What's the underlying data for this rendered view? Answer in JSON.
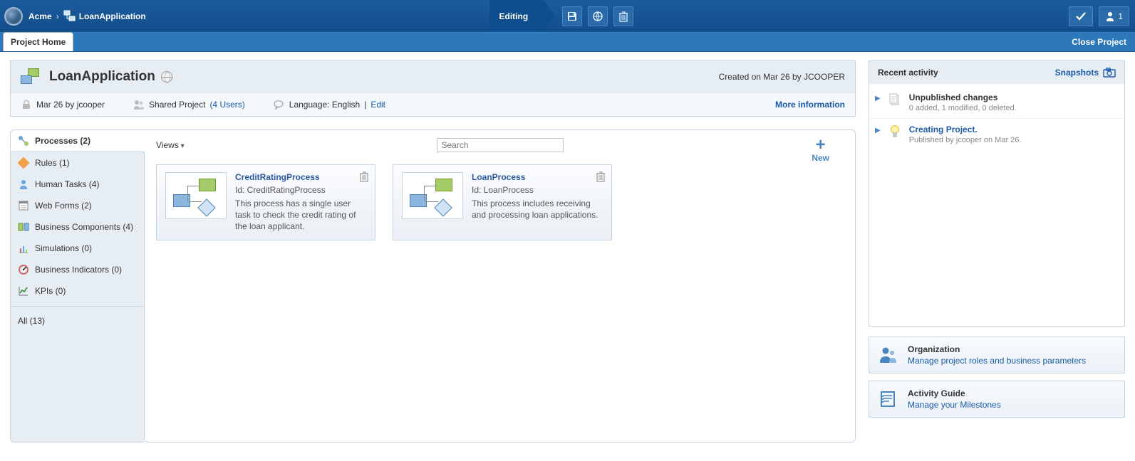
{
  "header": {
    "breadcrumb_root": "Acme",
    "breadcrumb_current": "LoanApplication",
    "mode_label": "Editing",
    "users_online": "1"
  },
  "tabs": {
    "project_home": "Project Home",
    "close_project": "Close Project"
  },
  "project": {
    "title": "LoanApplication",
    "created_text": "Created on Mar 26 by JCOOPER",
    "lock_text": "Mar 26 by jcooper",
    "shared_label": "Shared Project",
    "shared_count": "(4 Users)",
    "lang_label": "Language: English",
    "lang_sep": " | ",
    "lang_edit": "Edit",
    "more_info": "More information"
  },
  "categories": [
    {
      "label": "Processes (2)"
    },
    {
      "label": "Rules (1)"
    },
    {
      "label": "Human Tasks (4)"
    },
    {
      "label": "Web Forms (2)"
    },
    {
      "label": "Business Components (4)"
    },
    {
      "label": "Simulations (0)"
    },
    {
      "label": "Business Indicators (0)"
    },
    {
      "label": "KPIs (0)"
    }
  ],
  "categories_all": "All (13)",
  "workspace": {
    "views_label": "Views",
    "search_placeholder": "Search",
    "new_label": "New"
  },
  "cards": [
    {
      "title": "CreditRatingProcess",
      "id_line": "Id: CreditRatingProcess",
      "desc": "This process has a single user task to check the credit rating of the loan applicant."
    },
    {
      "title": "LoanProcess",
      "id_line": "Id: LoanProcess",
      "desc": "This process includes receiving and processing loan applications."
    }
  ],
  "recent": {
    "heading": "Recent activity",
    "snapshots": "Snapshots",
    "items": [
      {
        "title": "Unpublished changes",
        "sub": "0 added, 1 modified, 0 deleted.",
        "blue": false,
        "icon": "changes"
      },
      {
        "title": "Creating Project.",
        "sub": "Published by jcooper on Mar 26.",
        "blue": true,
        "icon": "bulb"
      }
    ]
  },
  "actions": {
    "org_title": "Organization",
    "org_link": "Manage project roles and business parameters",
    "guide_title": "Activity Guide",
    "guide_link": "Manage your Milestones"
  }
}
